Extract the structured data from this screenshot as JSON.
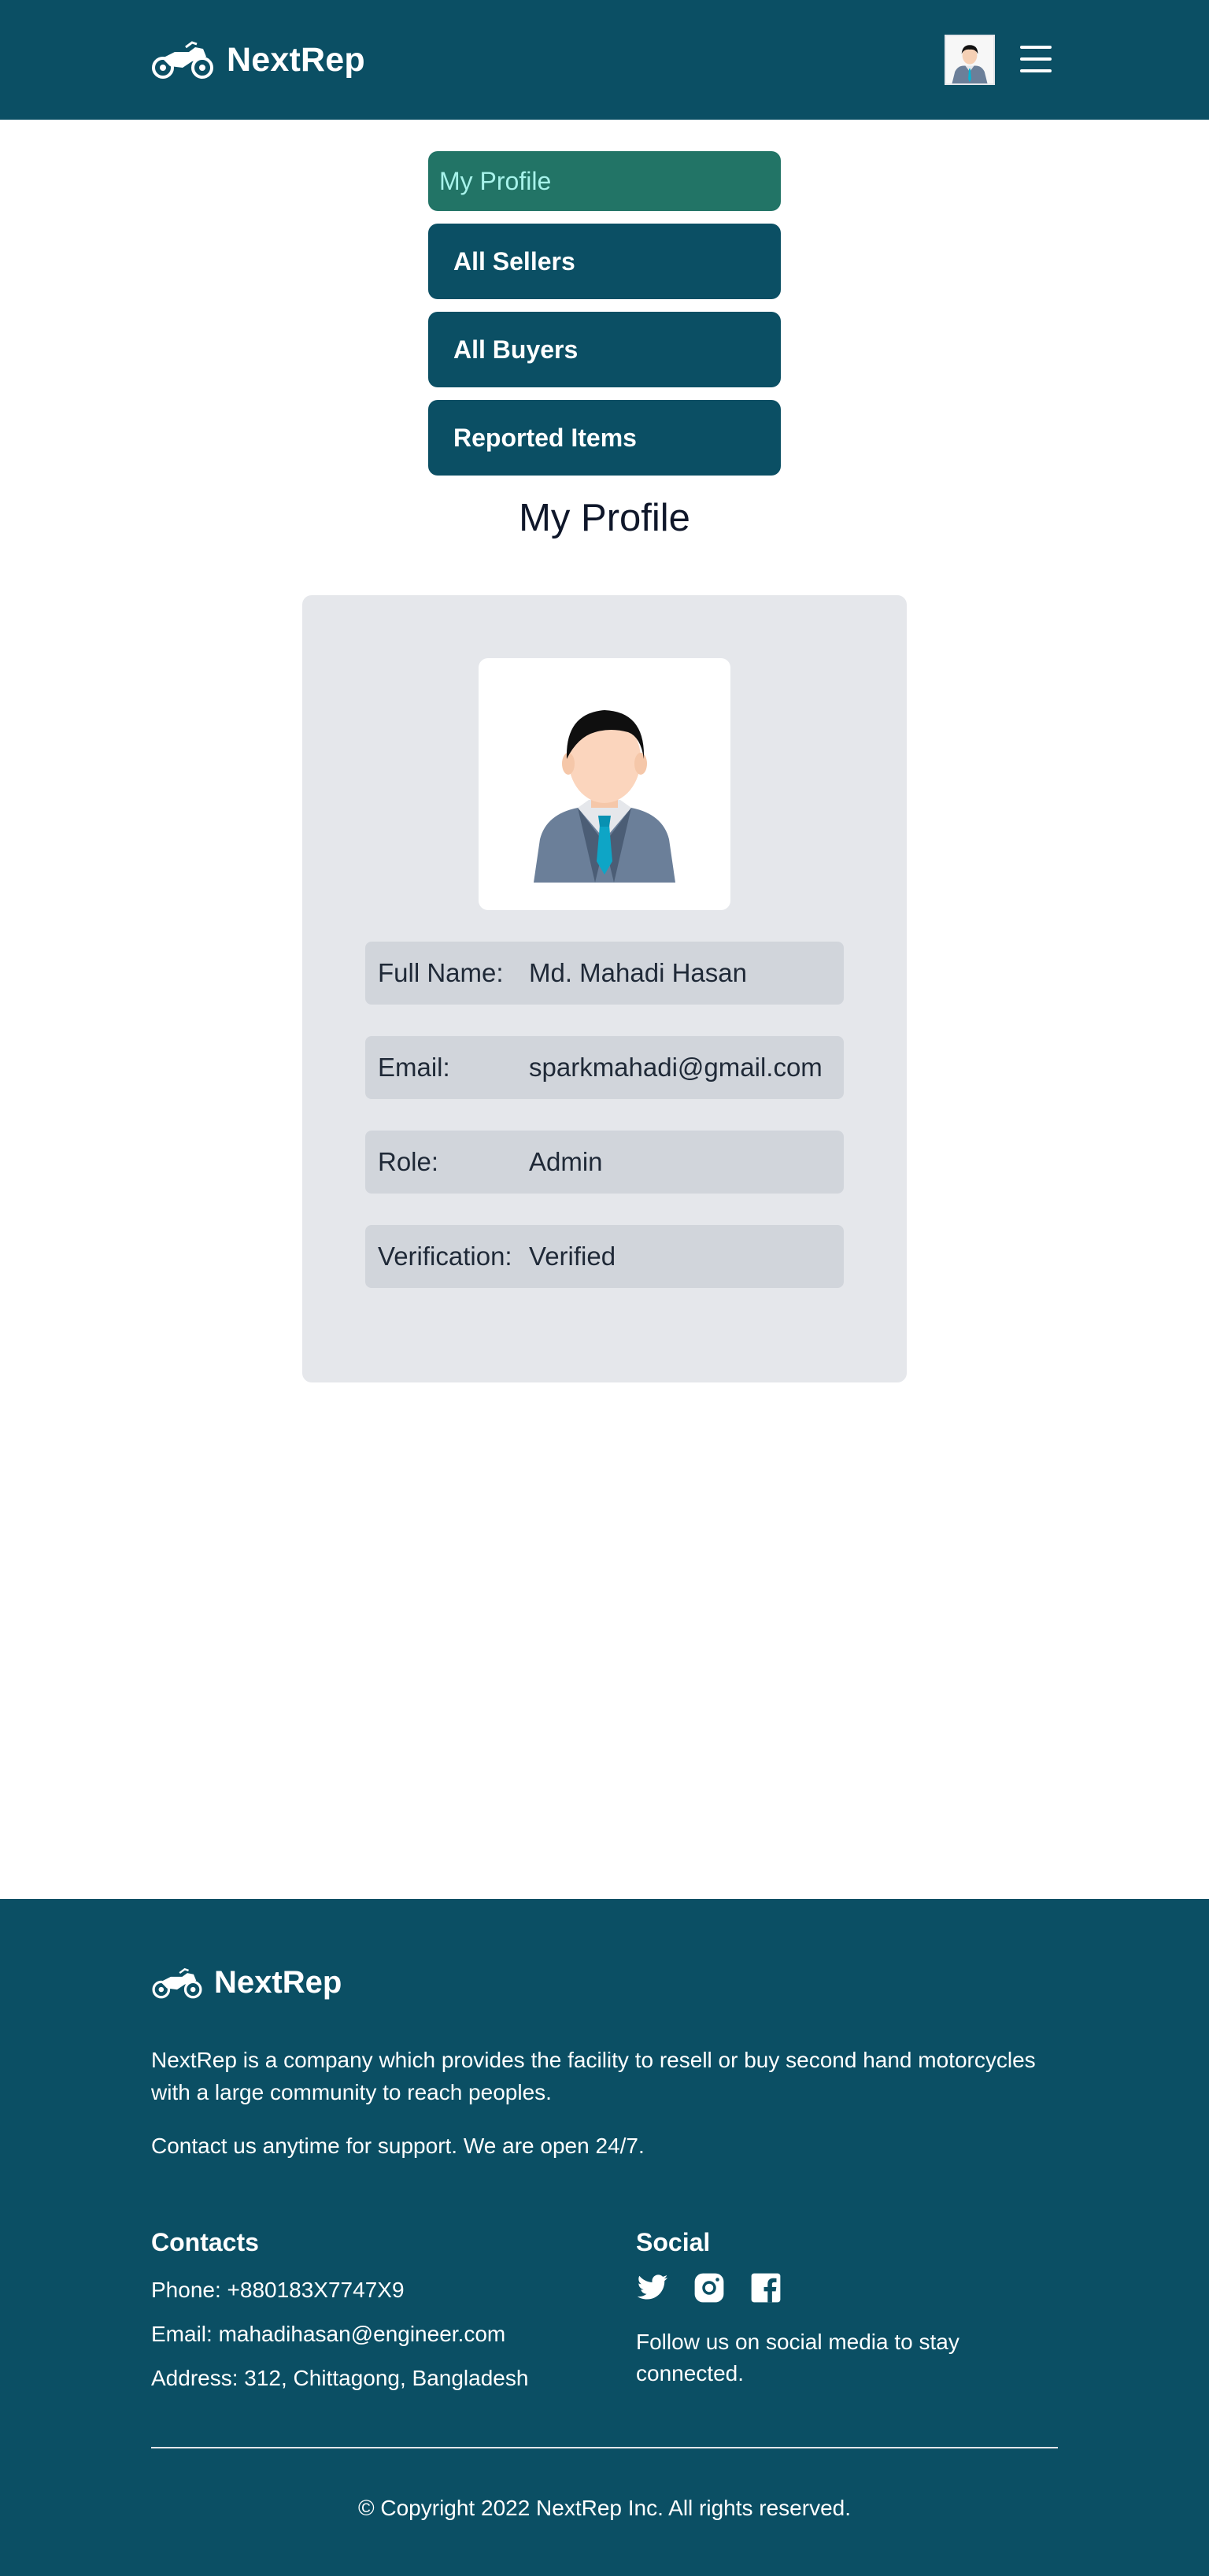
{
  "navbar": {
    "brand": "NextRep"
  },
  "menu": {
    "items": [
      {
        "label": "My Profile"
      },
      {
        "label": "All Sellers"
      },
      {
        "label": "All Buyers"
      },
      {
        "label": "Reported Items"
      }
    ]
  },
  "profile": {
    "title": "My Profile",
    "fields": [
      {
        "label": "Full Name:",
        "value": "Md. Mahadi Hasan"
      },
      {
        "label": "Email:",
        "value": "sparkmahadi@gmail.com"
      },
      {
        "label": "Role:",
        "value": "Admin"
      },
      {
        "label": "Verification:",
        "value": "Verified"
      }
    ]
  },
  "footer": {
    "brand": "NextRep",
    "description": "NextRep is a company which provides the facility to resell or buy second hand motorcycles with a large community to reach peoples.",
    "support": "Contact us anytime for support. We are open 24/7.",
    "contacts": {
      "title": "Contacts",
      "phone": "Phone: +880183X7747X9",
      "email": "Email: mahadihasan@engineer.com",
      "address": "Address: 312, Chittagong, Bangladesh"
    },
    "social": {
      "title": "Social",
      "icons": [
        "twitter-icon",
        "instagram-icon",
        "facebook-icon"
      ],
      "follow": "Follow us on social media to stay connected."
    },
    "copyright": "© Copyright 2022 NextRep Inc. All rights reserved."
  },
  "colors": {
    "primary": "#0b4f64",
    "active_menu": "#227466",
    "active_menu_text": "#a7f3eb",
    "card_bg": "#e5e7eb",
    "row_bg": "#d1d5db"
  }
}
